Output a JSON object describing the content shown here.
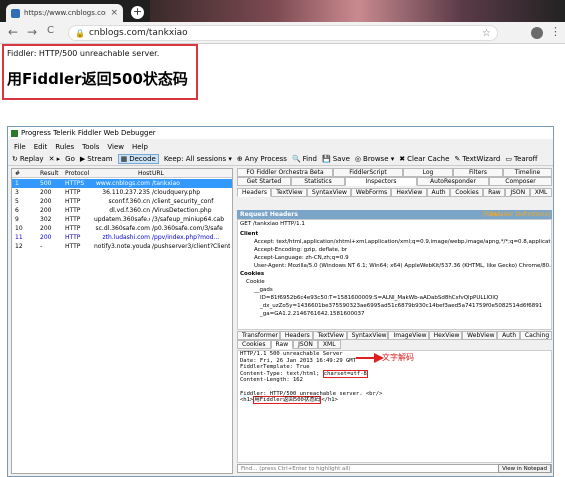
{
  "browser": {
    "tab_title": "https://www.cnblogs.com/tan",
    "tab_close": "×",
    "new_tab": "+",
    "back": "←",
    "forward": "→",
    "reload": "C",
    "url": "cnblogs.com/tankxiao",
    "menu": "⋮"
  },
  "page": {
    "error_line": "Fiddler: HTTP/500 unreachable server.",
    "heading": "用Fiddler返回500状态码"
  },
  "fiddler": {
    "title": "Progress Telerik Fiddler Web Debugger",
    "menu": [
      "File",
      "Edit",
      "Rules",
      "Tools",
      "View",
      "Help"
    ],
    "toolbar": [
      "Replay",
      "✕ ▸",
      "Go",
      "Stream",
      "Decode",
      "Keep: All sessions ▾",
      "Any Process",
      "Find",
      "Save",
      "Browse ▾",
      "Clear Cache",
      "TextWizard",
      "Tearoff"
    ],
    "sessions_header": [
      "#",
      "Result",
      "Protocol",
      "Host",
      "URL"
    ],
    "sessions": [
      {
        "num": "1",
        "result": "500",
        "protocol": "HTTPS",
        "host": "www.cnblogs.com",
        "url": "/tankxiao"
      },
      {
        "num": "3",
        "result": "200",
        "protocol": "HTTP",
        "host": "36.110.237.235",
        "url": "/cloudquery.php"
      },
      {
        "num": "5",
        "result": "200",
        "protocol": "HTTP",
        "host": "sconf.f.360.cn",
        "url": "/client_security_conf"
      },
      {
        "num": "6",
        "result": "200",
        "protocol": "HTTP",
        "host": "dl.vd.f.360.cn",
        "url": "/VirusDetection.php"
      },
      {
        "num": "9",
        "result": "302",
        "protocol": "HTTP",
        "host": "updatem.360safe.com",
        "url": "/3/safeup_miniup64.cab"
      },
      {
        "num": "10",
        "result": "200",
        "protocol": "HTTP",
        "host": "sc.dl.360safe.com",
        "url": "/p0.360safe.com/3/safe"
      },
      {
        "num": "11",
        "result": "200",
        "protocol": "HTTP",
        "host": "zth.ludashi.com",
        "url": "/ppv/index.php?mod..."
      },
      {
        "num": "12",
        "result": "-",
        "protocol": "HTTP",
        "host": "notify3.note.youdao.com",
        "url": "/pushserver3/client?Client..."
      }
    ],
    "top_tabs_1": [
      "FO Fiddler Orchestra Beta",
      "FiddlerScript",
      "Log",
      "Filters",
      "Timeline"
    ],
    "top_tabs_2": [
      "Get Started",
      "Statistics",
      "Inspectors",
      "AutoResponder",
      "Composer"
    ],
    "req_tabs": [
      "Headers",
      "TextView",
      "SyntaxView",
      "WebForms",
      "HexView",
      "Auth",
      "Cookies",
      "Raw",
      "JSON",
      "XML"
    ],
    "request_headers": {
      "title": "Request Headers",
      "raw": "[Raw]",
      "defs": "[Header Definitions]",
      "lines": [
        "GET /tankxiao HTTP/1.1",
        "Client",
        "Accept: text/html,application/xhtml+xml,application/xml;q=0.9,image/webp,image/apng,*/*;q=0.8,application/signed-exc",
        "Accept-Encoding: gzip, deflate, br",
        "Accept-Language: zh-CN,zh;q=0.9",
        "User-Agent: Mozilla/5.0 (Windows NT 6.1; Win64; x64) AppleWebKit/537.36 (KHTML, like Gecko) Chrome/80.0.3987.87 Sa",
        "Cookies",
        "Cookie",
        "__gads",
        "ID=81f6952b6c4e93c50:T=1581600009:S=ALNI_MakWb-aADabSd8hCsfvQlpPULLlOlQ",
        "_dx_uzZo5y=1436601be375590323ae6995ad51c6879b930c14bef3aed5a741759f0e5082514d6f6891",
        "_ga=GA1.2.2146761642.1581600037"
      ]
    },
    "resp_tabs_1": [
      "Transformer",
      "Headers",
      "TextView",
      "SyntaxView",
      "ImageView",
      "HexView",
      "WebView",
      "Auth",
      "Caching"
    ],
    "resp_tabs_2": [
      "Cookies",
      "Raw",
      "JSON",
      "XML"
    ],
    "response_lines": [
      "HTTP/1.1 500 unreachable Server",
      "Date: Fri, 26 Jan 2013 16:49:29 GMT",
      "FiddlerTemplate: True",
      "Content-Type: text/html; charset=utf-8",
      "Content-Length: 162",
      "",
      "Fiddler: HTTP/500 unreachable server. <br/>",
      "<h1>用Fiddler返回500状态码</h1>"
    ],
    "find_placeholder": "Find... (press Ctrl+Enter to highlight all)",
    "view_notepad": "View in Notepad"
  },
  "annotation": "文字解码",
  "colors": {
    "accent_red": "#e02020",
    "selection": "#3399ff",
    "header_blue": "#7aa5c9"
  }
}
